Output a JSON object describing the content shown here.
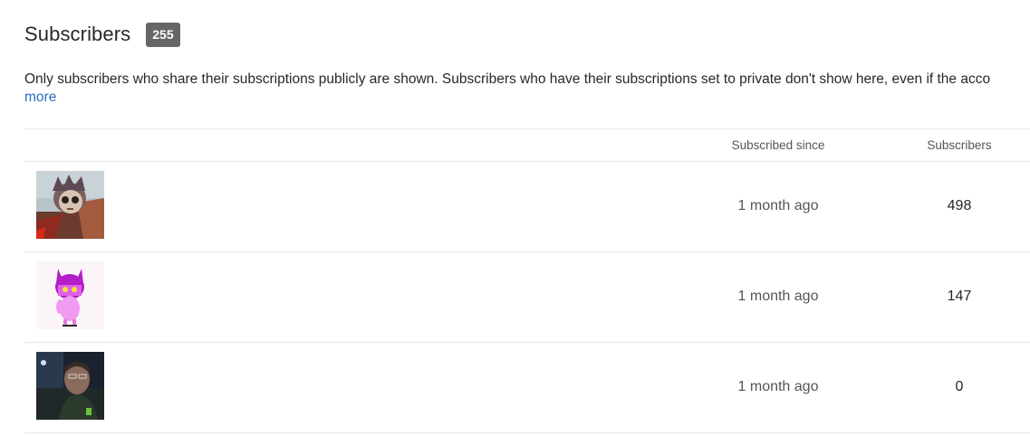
{
  "header": {
    "title": "Subscribers",
    "count": "255"
  },
  "description": {
    "text": "Only subscribers who share their subscriptions publicly are shown. Subscribers who have their subscriptions set to private don't show here, even if the acco",
    "more_label": "more"
  },
  "table": {
    "columns": {
      "since": "Subscribed since",
      "subscribers": "Subscribers"
    },
    "rows": [
      {
        "avatar": "cartoon-character-avatar",
        "since": "1 month ago",
        "subscribers": "498"
      },
      {
        "avatar": "pink-cat-character-avatar",
        "since": "1 month ago",
        "subscribers": "147"
      },
      {
        "avatar": "person-photo-avatar",
        "since": "1 month ago",
        "subscribers": "0"
      }
    ]
  }
}
